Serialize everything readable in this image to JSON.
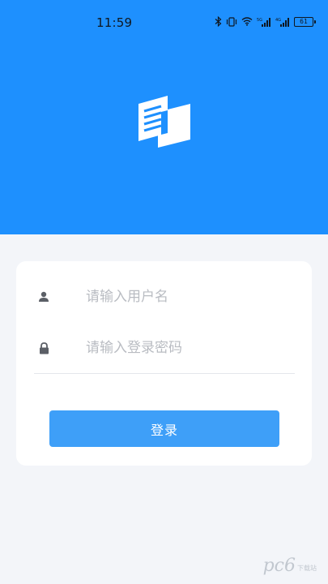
{
  "status_bar": {
    "time": "11:59",
    "battery_level": "61",
    "icons": [
      "bluetooth-icon",
      "vibrate-icon",
      "wifi-icon",
      "cellular-signal-5g-icon",
      "cellular-signal-4g-icon",
      "battery-icon"
    ]
  },
  "header": {
    "background_color": "#1e90fe",
    "logo_icon": "document-logo-icon"
  },
  "login_form": {
    "username": {
      "icon": "user-icon",
      "value": "",
      "placeholder": "请输入用户名"
    },
    "password": {
      "icon": "lock-icon",
      "value": "",
      "placeholder": "请输入登录密码"
    },
    "submit_label": "登录",
    "button_color": "#3e9ff8"
  },
  "watermark": {
    "text": "pc6",
    "subtext": "下载站"
  }
}
